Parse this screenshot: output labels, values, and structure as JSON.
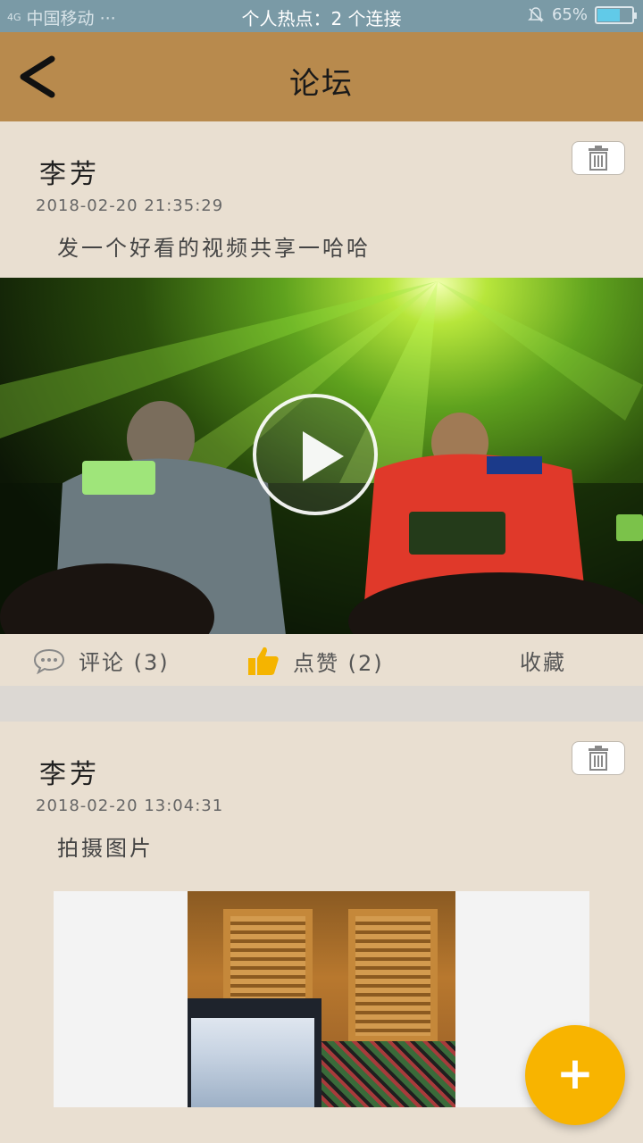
{
  "status_bar": {
    "network": "4G",
    "carrier": "中国移动 ···",
    "hotspot": "个人热点：2 个连接",
    "battery": "65%",
    "battery_level": 0.65
  },
  "header": {
    "title": "论坛",
    "back_icon": "chevron-left-icon"
  },
  "posts": [
    {
      "author": "李芳",
      "time": "2018-02-20 21:35:29",
      "content": "发一个好看的视频共享一哈哈",
      "media_type": "video",
      "actions": {
        "comment": "评论 (3)",
        "like": "点赞 (2)",
        "favorite": "收藏"
      }
    },
    {
      "author": "李芳",
      "time": "2018-02-20 13:04:31",
      "content": "拍摄图片",
      "media_type": "image"
    }
  ],
  "fab": {
    "label": "+",
    "color": "#f8b400"
  },
  "colors": {
    "header_bg": "#b88a4d",
    "page_bg": "#e9dfd1",
    "like_icon": "#f5b400"
  }
}
